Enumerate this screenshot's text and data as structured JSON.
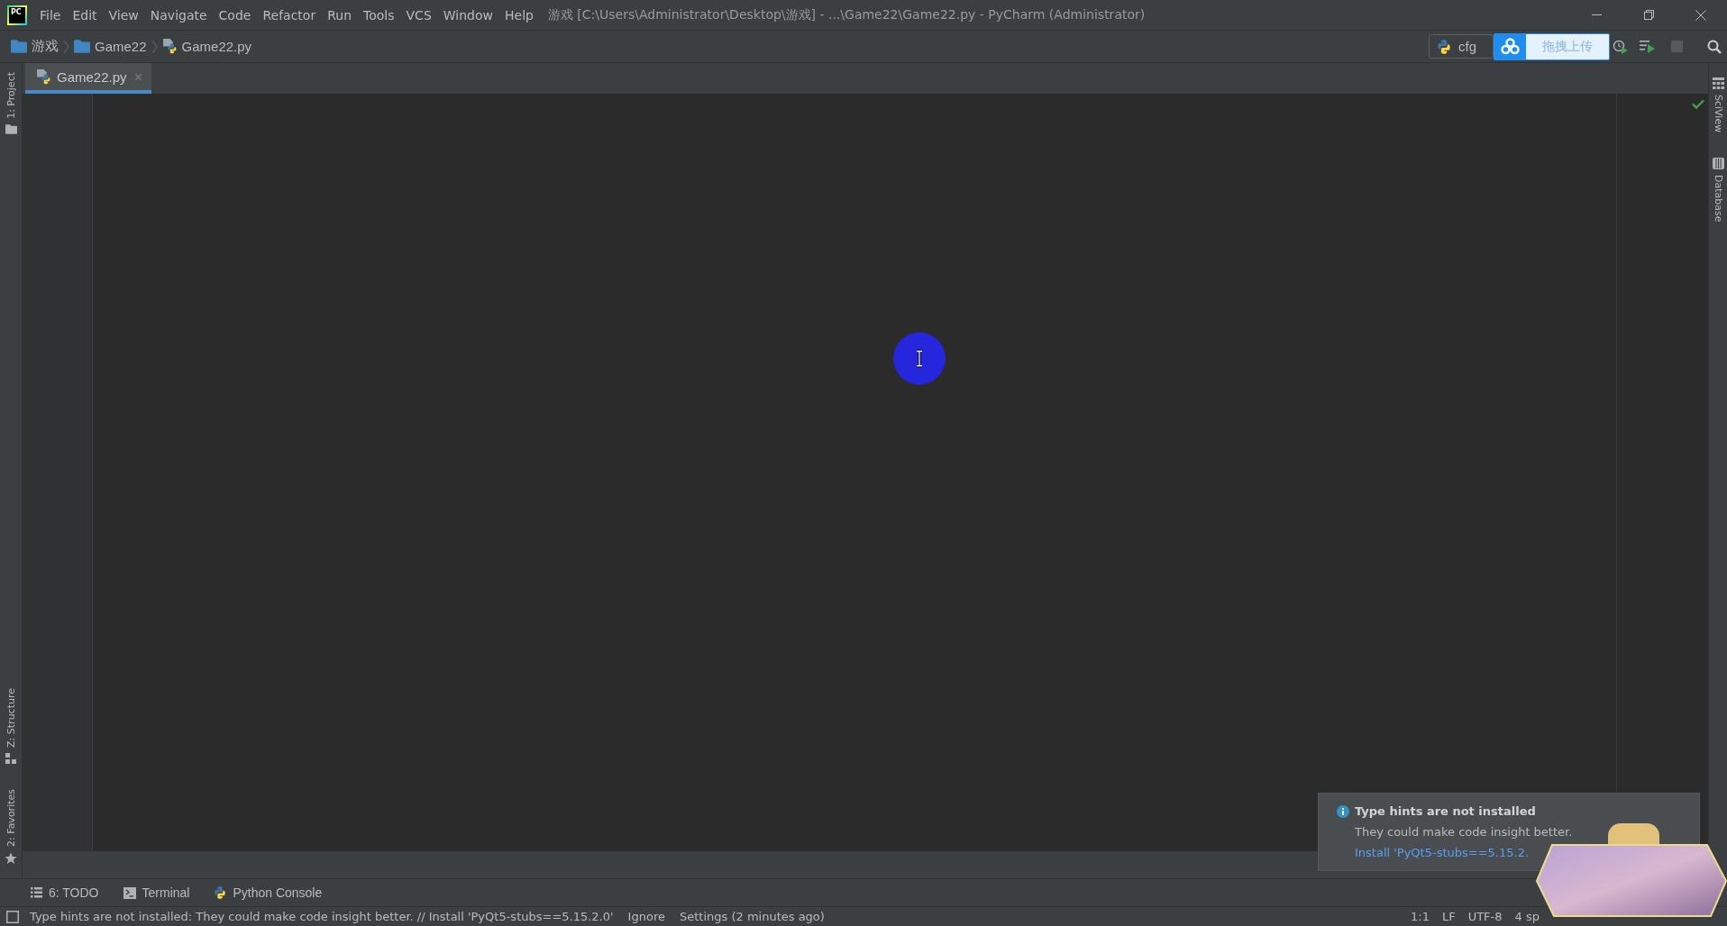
{
  "window": {
    "logo_text": "PC",
    "title": "游戏 [C:\\Users\\Administrator\\Desktop\\游戏] - ...\\Game22\\Game22.py - PyCharm (Administrator)"
  },
  "menu": [
    "File",
    "Edit",
    "View",
    "Navigate",
    "Code",
    "Refactor",
    "Run",
    "Tools",
    "VCS",
    "Window",
    "Help"
  ],
  "breadcrumbs": [
    {
      "label": "游戏",
      "kind": "folder"
    },
    {
      "label": "Game22",
      "kind": "folder"
    },
    {
      "label": "Game22.py",
      "kind": "python"
    }
  ],
  "toolbar": {
    "run_configuration": "cfg",
    "upload_button": "拖拽上传",
    "stop_disabled": true
  },
  "left_stripe": {
    "top": [
      {
        "label": "1: Project",
        "kind": "project"
      }
    ],
    "bottom": [
      {
        "label": "Z: Structure",
        "kind": "structure"
      },
      {
        "label": "2: Favorites",
        "kind": "favorites"
      }
    ]
  },
  "right_stripe": [
    {
      "label": "SciView",
      "kind": "sciview"
    },
    {
      "label": "Database",
      "kind": "database"
    }
  ],
  "tabs": [
    {
      "label": "Game22.py",
      "selected": true
    }
  ],
  "tool_windows": [
    {
      "label": "6: TODO",
      "kind": "todo"
    },
    {
      "label": "Terminal",
      "kind": "terminal"
    },
    {
      "label": "Python Console",
      "kind": "python"
    }
  ],
  "notification": {
    "title": "Type hints are not installed",
    "body": "They could make code insight better.",
    "link": "Install 'PyQt5-stubs==5.15.2."
  },
  "status_bar": {
    "message": "Type hints are not installed: They could make code insight better. // Install 'PyQt5-stubs==5.15.2.0'",
    "actions": [
      "Ignore",
      "Settings (2 minutes ago)"
    ],
    "items": [
      "1:1",
      "LF",
      "UTF-8",
      "4 sp"
    ]
  }
}
